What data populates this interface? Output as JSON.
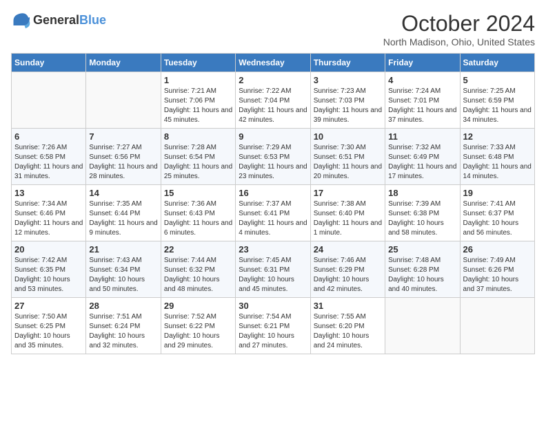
{
  "header": {
    "logo_general": "General",
    "logo_blue": "Blue",
    "month": "October 2024",
    "location": "North Madison, Ohio, United States"
  },
  "weekdays": [
    "Sunday",
    "Monday",
    "Tuesday",
    "Wednesday",
    "Thursday",
    "Friday",
    "Saturday"
  ],
  "weeks": [
    [
      {
        "day": "",
        "content": ""
      },
      {
        "day": "",
        "content": ""
      },
      {
        "day": "1",
        "content": "Sunrise: 7:21 AM\nSunset: 7:06 PM\nDaylight: 11 hours and 45 minutes."
      },
      {
        "day": "2",
        "content": "Sunrise: 7:22 AM\nSunset: 7:04 PM\nDaylight: 11 hours and 42 minutes."
      },
      {
        "day": "3",
        "content": "Sunrise: 7:23 AM\nSunset: 7:03 PM\nDaylight: 11 hours and 39 minutes."
      },
      {
        "day": "4",
        "content": "Sunrise: 7:24 AM\nSunset: 7:01 PM\nDaylight: 11 hours and 37 minutes."
      },
      {
        "day": "5",
        "content": "Sunrise: 7:25 AM\nSunset: 6:59 PM\nDaylight: 11 hours and 34 minutes."
      }
    ],
    [
      {
        "day": "6",
        "content": "Sunrise: 7:26 AM\nSunset: 6:58 PM\nDaylight: 11 hours and 31 minutes."
      },
      {
        "day": "7",
        "content": "Sunrise: 7:27 AM\nSunset: 6:56 PM\nDaylight: 11 hours and 28 minutes."
      },
      {
        "day": "8",
        "content": "Sunrise: 7:28 AM\nSunset: 6:54 PM\nDaylight: 11 hours and 25 minutes."
      },
      {
        "day": "9",
        "content": "Sunrise: 7:29 AM\nSunset: 6:53 PM\nDaylight: 11 hours and 23 minutes."
      },
      {
        "day": "10",
        "content": "Sunrise: 7:30 AM\nSunset: 6:51 PM\nDaylight: 11 hours and 20 minutes."
      },
      {
        "day": "11",
        "content": "Sunrise: 7:32 AM\nSunset: 6:49 PM\nDaylight: 11 hours and 17 minutes."
      },
      {
        "day": "12",
        "content": "Sunrise: 7:33 AM\nSunset: 6:48 PM\nDaylight: 11 hours and 14 minutes."
      }
    ],
    [
      {
        "day": "13",
        "content": "Sunrise: 7:34 AM\nSunset: 6:46 PM\nDaylight: 11 hours and 12 minutes."
      },
      {
        "day": "14",
        "content": "Sunrise: 7:35 AM\nSunset: 6:44 PM\nDaylight: 11 hours and 9 minutes."
      },
      {
        "day": "15",
        "content": "Sunrise: 7:36 AM\nSunset: 6:43 PM\nDaylight: 11 hours and 6 minutes."
      },
      {
        "day": "16",
        "content": "Sunrise: 7:37 AM\nSunset: 6:41 PM\nDaylight: 11 hours and 4 minutes."
      },
      {
        "day": "17",
        "content": "Sunrise: 7:38 AM\nSunset: 6:40 PM\nDaylight: 11 hours and 1 minute."
      },
      {
        "day": "18",
        "content": "Sunrise: 7:39 AM\nSunset: 6:38 PM\nDaylight: 10 hours and 58 minutes."
      },
      {
        "day": "19",
        "content": "Sunrise: 7:41 AM\nSunset: 6:37 PM\nDaylight: 10 hours and 56 minutes."
      }
    ],
    [
      {
        "day": "20",
        "content": "Sunrise: 7:42 AM\nSunset: 6:35 PM\nDaylight: 10 hours and 53 minutes."
      },
      {
        "day": "21",
        "content": "Sunrise: 7:43 AM\nSunset: 6:34 PM\nDaylight: 10 hours and 50 minutes."
      },
      {
        "day": "22",
        "content": "Sunrise: 7:44 AM\nSunset: 6:32 PM\nDaylight: 10 hours and 48 minutes."
      },
      {
        "day": "23",
        "content": "Sunrise: 7:45 AM\nSunset: 6:31 PM\nDaylight: 10 hours and 45 minutes."
      },
      {
        "day": "24",
        "content": "Sunrise: 7:46 AM\nSunset: 6:29 PM\nDaylight: 10 hours and 42 minutes."
      },
      {
        "day": "25",
        "content": "Sunrise: 7:48 AM\nSunset: 6:28 PM\nDaylight: 10 hours and 40 minutes."
      },
      {
        "day": "26",
        "content": "Sunrise: 7:49 AM\nSunset: 6:26 PM\nDaylight: 10 hours and 37 minutes."
      }
    ],
    [
      {
        "day": "27",
        "content": "Sunrise: 7:50 AM\nSunset: 6:25 PM\nDaylight: 10 hours and 35 minutes."
      },
      {
        "day": "28",
        "content": "Sunrise: 7:51 AM\nSunset: 6:24 PM\nDaylight: 10 hours and 32 minutes."
      },
      {
        "day": "29",
        "content": "Sunrise: 7:52 AM\nSunset: 6:22 PM\nDaylight: 10 hours and 29 minutes."
      },
      {
        "day": "30",
        "content": "Sunrise: 7:54 AM\nSunset: 6:21 PM\nDaylight: 10 hours and 27 minutes."
      },
      {
        "day": "31",
        "content": "Sunrise: 7:55 AM\nSunset: 6:20 PM\nDaylight: 10 hours and 24 minutes."
      },
      {
        "day": "",
        "content": ""
      },
      {
        "day": "",
        "content": ""
      }
    ]
  ]
}
